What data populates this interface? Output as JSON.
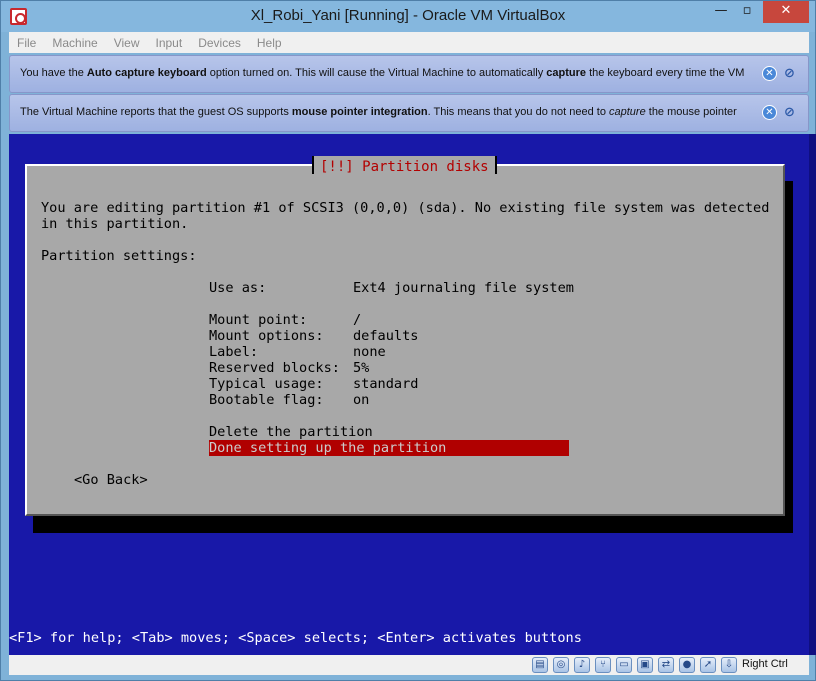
{
  "window": {
    "title": "Xl_Robi_Yani [Running] - Oracle VM VirtualBox"
  },
  "menu": [
    "File",
    "Machine",
    "View",
    "Input",
    "Devices",
    "Help"
  ],
  "notices": {
    "keyboard": {
      "t1": "You have the ",
      "b1": "Auto capture keyboard",
      "t2": " option turned on. This will cause the Virtual Machine to automatically ",
      "b2": "capture",
      "t3": " the keyboard every time the VM"
    },
    "mouse": {
      "t1": "The Virtual Machine reports that the guest OS supports ",
      "b1": "mouse pointer integration",
      "t2": ". This means that you do not need to ",
      "i1": "capture",
      "t3": " the mouse pointer"
    }
  },
  "dialog": {
    "title": "[!!] Partition disks",
    "intro_line1": "You are editing partition #1 of SCSI3 (0,0,0) (sda). No existing file system was detected",
    "intro_line2": "in this partition.",
    "settings_label": "Partition settings:",
    "settings": [
      {
        "label": "Use as:",
        "value": "Ext4 journaling file system"
      },
      {
        "label": "Mount point:",
        "value": "/"
      },
      {
        "label": "Mount options:",
        "value": "defaults"
      },
      {
        "label": "Label:",
        "value": "none"
      },
      {
        "label": "Reserved blocks:",
        "value": "5%"
      },
      {
        "label": "Typical usage:",
        "value": "standard"
      },
      {
        "label": "Bootable flag:",
        "value": "on"
      }
    ],
    "actions": {
      "delete": "Delete the partition",
      "done": "Done setting up the partition"
    },
    "go_back": "<Go Back>"
  },
  "helpline": "<F1> for help; <Tab> moves; <Space> selects; <Enter> activates buttons",
  "statusbar": {
    "host_key": "Right Ctrl"
  }
}
